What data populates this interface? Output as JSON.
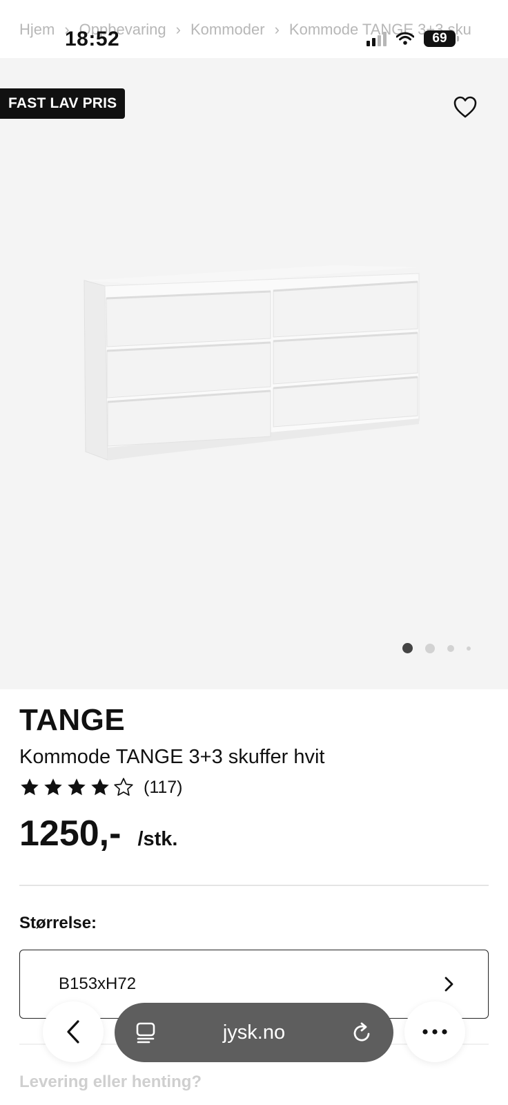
{
  "breadcrumb": {
    "items": [
      "Hjem",
      "Oppbevaring",
      "Kommoder",
      "Kommode TANGE 3+3 sku"
    ]
  },
  "status_bar": {
    "time": "18:52",
    "battery": "69"
  },
  "hero": {
    "badge": "FAST LAV PRIS",
    "carousel": {
      "count": 4,
      "active_index": 0
    },
    "bg_color": "#f4f4f4"
  },
  "product": {
    "brand": "TANGE",
    "name": "Kommode TANGE 3+3 skuffer hvit",
    "rating_value": 4,
    "rating_max": 5,
    "review_count": "(117)",
    "price": "1250,-",
    "unit": "/stk."
  },
  "size": {
    "label": "Størrelse:",
    "value": "B153xH72"
  },
  "delivery": {
    "heading": "Levering eller henting?"
  },
  "browser": {
    "domain": "jysk.no"
  },
  "icons": {
    "heart": "heart-outline-icon",
    "back": "chevron-left-icon",
    "more": "more-dots-icon",
    "tabs": "tab-overview-icon",
    "reload": "reload-icon",
    "chevron": "chevron-right-icon"
  }
}
